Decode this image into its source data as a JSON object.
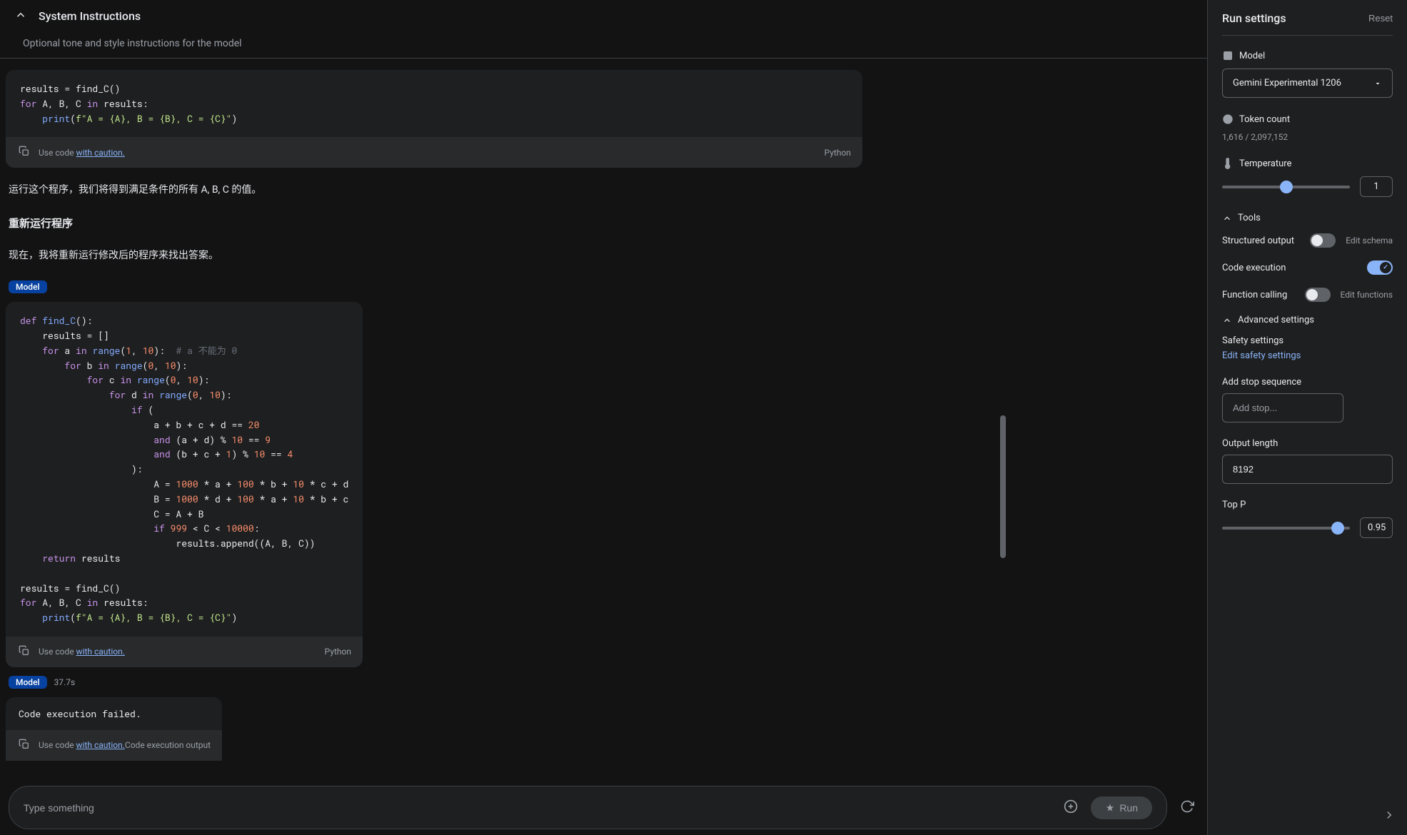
{
  "header": {
    "system_instructions_title": "System Instructions",
    "system_instructions_placeholder": "Optional tone and style instructions for the model"
  },
  "content": {
    "code1": {
      "text": "results = find_C()\nfor A, B, C in results:\n    print(f\"A = {A}, B = {B}, C = {C}\")",
      "footer_use": "Use code ",
      "footer_caution": "with caution.",
      "language": "Python"
    },
    "para1": "运行这个程序，我们将得到满足条件的所有 A, B, C 的值。",
    "heading1": "重新运行程序",
    "para2": "现在，我将重新运行修改后的程序来找出答案。",
    "badge1": "Model",
    "code2": {
      "text": "def find_C():\n    results = []\n    for a in range(1, 10):  # a 不能为 0\n        for b in range(0, 10):\n            for c in range(0, 10):\n                for d in range(0, 10):\n                    if (\n                        a + b + c + d == 20\n                        and (a + d) % 10 == 9\n                        and (b + c + 1) % 10 == 4\n                    ):\n                        A = 1000 * a + 100 * b + 10 * c + d\n                        B = 1000 * d + 100 * a + 10 * b + c\n                        C = A + B\n                        if 999 < C < 10000:\n                            results.append((A, B, C))\n    return results\n\nresults = find_C()\nfor A, B, C in results:\n    print(f\"A = {A}, B = {B}, C = {C}\")",
      "footer_use": "Use code ",
      "footer_caution": "with caution.",
      "language": "Python"
    },
    "badge2": "Model",
    "timing2": "37.7s",
    "exec_failed": "Code execution failed.",
    "code3": {
      "footer_use": "Use code ",
      "footer_caution": "with caution.",
      "footer_extra": "Code execution output"
    }
  },
  "input": {
    "placeholder": "Type something",
    "run_label": "Run"
  },
  "sidebar": {
    "title": "Run settings",
    "reset": "Reset",
    "model_label": "Model",
    "model_value": "Gemini Experimental 1206",
    "token_label": "Token count",
    "token_value": "1,616 / 2,097,152",
    "temp_label": "Temperature",
    "temp_value": "1",
    "tools_label": "Tools",
    "structured_output": "Structured output",
    "edit_schema": "Edit schema",
    "code_execution": "Code execution",
    "function_calling": "Function calling",
    "edit_functions": "Edit functions",
    "advanced_label": "Advanced settings",
    "safety_label": "Safety settings",
    "edit_safety": "Edit safety settings",
    "stop_label": "Add stop sequence",
    "stop_placeholder": "Add stop...",
    "output_label": "Output length",
    "output_value": "8192",
    "topp_label": "Top P",
    "topp_value": "0.95"
  }
}
